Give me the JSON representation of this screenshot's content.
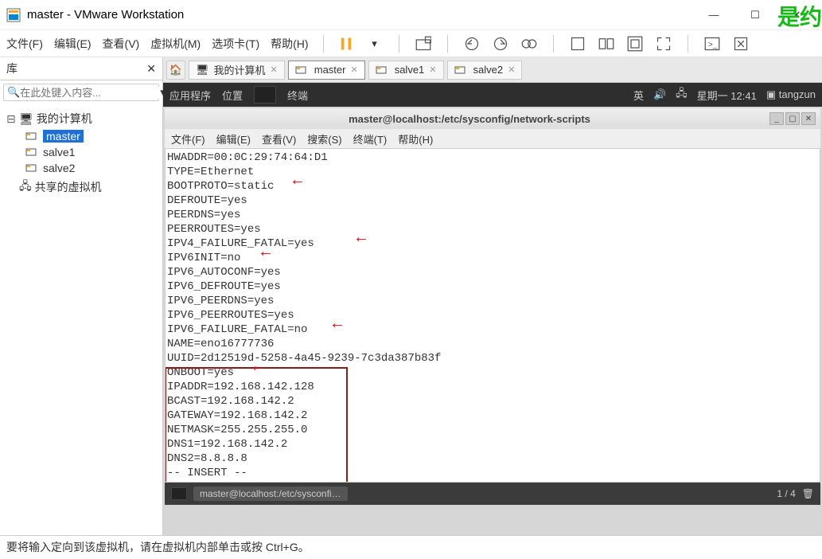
{
  "window": {
    "title": "master - VMware Workstation"
  },
  "winctrl": {
    "min": "—",
    "max": "☐",
    "close": "✕"
  },
  "overlay": "是约",
  "menu": {
    "file": "文件(F)",
    "edit": "编辑(E)",
    "view": "查看(V)",
    "vm": "虚拟机(M)",
    "tabs": "选项卡(T)",
    "help": "帮助(H)"
  },
  "side": {
    "title": "库",
    "close": "✕",
    "search_placeholder": "在此处键入内容...",
    "root": "我的计算机",
    "items": [
      "master",
      "salve1",
      "salve2"
    ],
    "shared": "共享的虚拟机"
  },
  "tabs": [
    {
      "icon": "home",
      "label": "我的计算机",
      "close": "✕"
    },
    {
      "icon": "vm",
      "label": "master",
      "close": "✕",
      "active": true
    },
    {
      "icon": "vm",
      "label": "salve1",
      "close": "✕"
    },
    {
      "icon": "vm",
      "label": "salve2",
      "close": "✕"
    }
  ],
  "gnome": {
    "apps": "应用程序",
    "places": "位置",
    "term": "终端",
    "lang": "英",
    "clock": "星期一  12:41",
    "user": "tangzun"
  },
  "term": {
    "title": "master@localhost:/etc/sysconfig/network-scripts",
    "menu": {
      "file": "文件(F)",
      "edit": "编辑(E)",
      "view": "查看(V)",
      "search": "搜索(S)",
      "terminal": "终端(T)",
      "help": "帮助(H)"
    },
    "lines": [
      "HWADDR=00:0C:29:74:64:D1",
      "TYPE=Ethernet",
      "BOOTPROTO=static",
      "DEFROUTE=yes",
      "PEERDNS=yes",
      "PEERROUTES=yes",
      "IPV4_FAILURE_FATAL=yes",
      "IPV6INIT=no",
      "IPV6_AUTOCONF=yes",
      "IPV6_DEFROUTE=yes",
      "IPV6_PEERDNS=yes",
      "IPV6_PEERROUTES=yes",
      "IPV6_FAILURE_FATAL=no",
      "NAME=eno16777736",
      "UUID=2d12519d-5258-4a45-9239-7c3da387b83f",
      "ONBOOT=yes",
      "IPADDR=192.168.142.128",
      "BCAST=192.168.142.2",
      "GATEWAY=192.168.142.2",
      "NETMASK=255.255.255.0",
      "DNS1=192.168.142.2",
      "DNS2=8.8.8.8",
      "-- INSERT --"
    ],
    "task": "master@localhost:/etc/sysconfi…",
    "page": "1 / 4"
  },
  "status": "要将输入定向到该虚拟机，请在虚拟机内部单击或按 Ctrl+G。"
}
